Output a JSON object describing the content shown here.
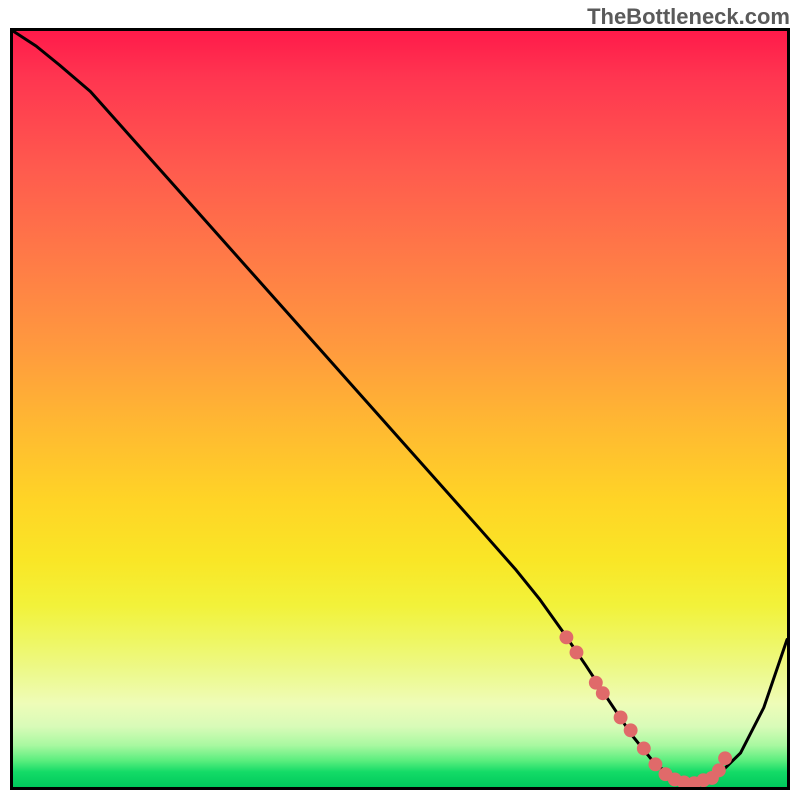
{
  "watermark": "TheBottleneck.com",
  "chart_data": {
    "type": "line",
    "title": "",
    "xlabel": "",
    "ylabel": "",
    "xlim": [
      0,
      100
    ],
    "ylim": [
      0,
      100
    ],
    "series": [
      {
        "name": "curve",
        "x": [
          0,
          3,
          6,
          10,
          20,
          30,
          40,
          50,
          60,
          65,
          68,
          71,
          74,
          77,
          80,
          83,
          86,
          88,
          91,
          94,
          97,
          100
        ],
        "y": [
          100,
          98,
          95.5,
          92,
          80.5,
          69,
          57.5,
          46,
          34.5,
          28.7,
          24.9,
          20.6,
          16.1,
          11.4,
          6.8,
          3.0,
          0.9,
          0.5,
          1.5,
          4.5,
          10.5,
          19.5
        ]
      }
    ],
    "markers": {
      "name": "highlight-dots",
      "color": "#e06a6a",
      "points_xy": [
        [
          71.5,
          19.8
        ],
        [
          72.8,
          17.8
        ],
        [
          75.3,
          13.8
        ],
        [
          76.2,
          12.4
        ],
        [
          78.5,
          9.2
        ],
        [
          79.8,
          7.5
        ],
        [
          81.5,
          5.1
        ],
        [
          83.0,
          3.0
        ],
        [
          84.3,
          1.7
        ],
        [
          85.5,
          1.0
        ],
        [
          86.7,
          0.6
        ],
        [
          88.0,
          0.5
        ],
        [
          89.2,
          0.9
        ],
        [
          90.3,
          1.2
        ],
        [
          91.2,
          2.2
        ],
        [
          92.0,
          3.8
        ]
      ]
    }
  }
}
